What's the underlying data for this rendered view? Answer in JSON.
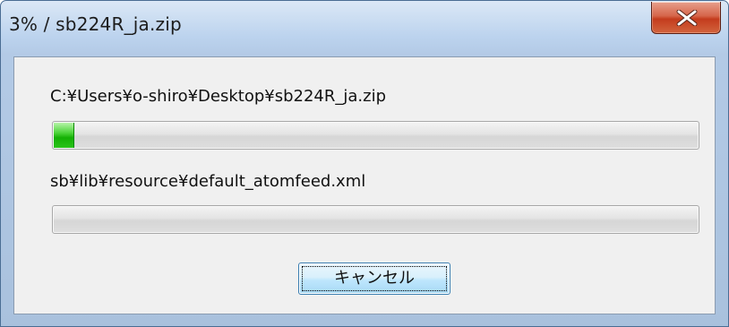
{
  "window": {
    "title": "3% / sb224R_ja.zip",
    "close_icon": "close-x-icon"
  },
  "archive": {
    "path": "C:¥Users¥o-shiro¥Desktop¥sb224R_ja.zip",
    "progress": 0.03
  },
  "current_file": {
    "path": "sb¥lib¥resource¥default_atomfeed.xml",
    "progress": 0
  },
  "buttons": {
    "cancel_label": "キャンセル"
  },
  "colors": {
    "progress_fill": "#14b004",
    "close_button": "#c43c1d",
    "title_bar": "#bcd3ee"
  }
}
